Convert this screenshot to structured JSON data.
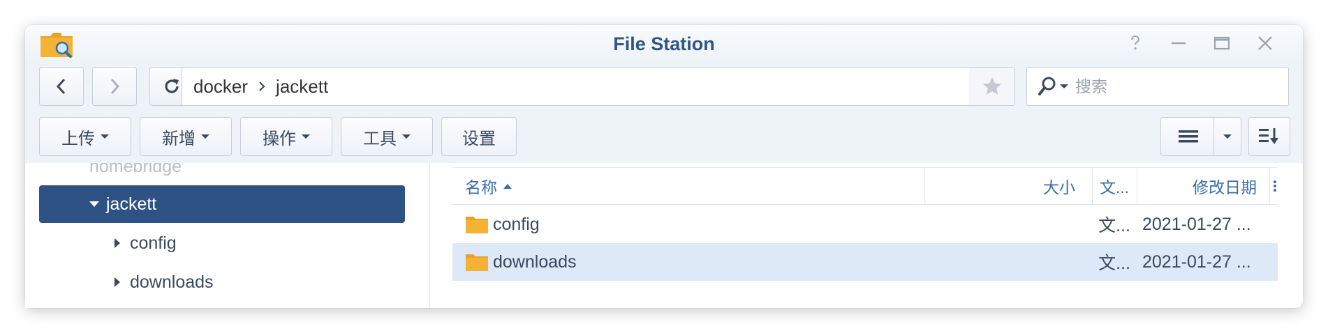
{
  "window": {
    "title": "File Station"
  },
  "icons": {
    "app": "file-station-folder-icon",
    "help": "help-icon",
    "minimize": "minimize-icon",
    "maximize": "maximize-icon",
    "close": "close-icon",
    "back": "chevron-left-icon",
    "forward": "chevron-right-icon",
    "refresh": "refresh-icon",
    "favorite": "star-icon",
    "search": "search-icon",
    "list_view": "list-view-icon",
    "sort": "sort-icon",
    "folder": "folder-icon",
    "more_columns": "more-vertical-icon"
  },
  "address": {
    "crumbs": [
      "docker",
      "jackett"
    ]
  },
  "search": {
    "placeholder": "搜索"
  },
  "toolbar": {
    "upload": "上传",
    "create": "新增",
    "action": "操作",
    "tools": "工具",
    "settings": "设置"
  },
  "tree": {
    "items": [
      {
        "label": "homebridge",
        "partial": true
      },
      {
        "label": "jackett",
        "selected": true
      },
      {
        "label": "config"
      },
      {
        "label": "downloads"
      }
    ]
  },
  "columns": {
    "name": "名称",
    "size": "大小",
    "type": "文...",
    "modified": "修改日期"
  },
  "files": [
    {
      "name": "config",
      "size": "",
      "type": "文...",
      "modified": "2021-01-27 ...",
      "selected": false
    },
    {
      "name": "downloads",
      "size": "",
      "type": "文...",
      "modified": "2021-01-27 ...",
      "selected": true
    }
  ],
  "colors": {
    "title": "#2f5684",
    "selection_tree": "#2e5283",
    "selection_row": "#dde9f7",
    "folder": "#f5b336",
    "header_text": "#3a6ea8"
  }
}
